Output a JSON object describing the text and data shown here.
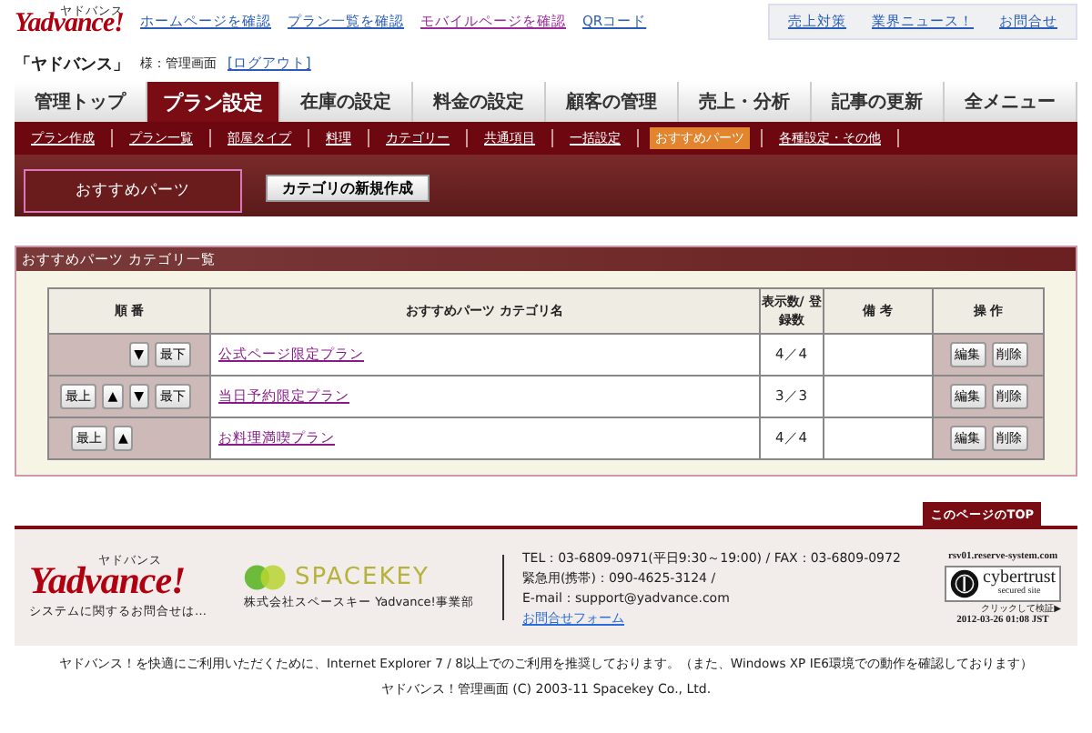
{
  "header": {
    "logo": "Yadvance!",
    "logo_kana": "ヤドバンス",
    "links": [
      "ホームページを確認",
      "プラン一覧を確認",
      "モバイルページを確認",
      "QRコード"
    ],
    "right_links": [
      "売上対策",
      "業界ニュース！",
      "お問合せ"
    ]
  },
  "account": {
    "name": "「ヤドバンス」",
    "suffix": "様：管理画面",
    "logout": "[ログアウト]"
  },
  "tabs": [
    {
      "label": "管理トップ",
      "selected": false
    },
    {
      "label": "プラン設定",
      "selected": true
    },
    {
      "label": "在庫の設定",
      "selected": false
    },
    {
      "label": "料金の設定",
      "selected": false
    },
    {
      "label": "顧客の管理",
      "selected": false
    },
    {
      "label": "売上・分析",
      "selected": false
    },
    {
      "label": "記事の更新",
      "selected": false
    },
    {
      "label": "全メニュー",
      "selected": false
    }
  ],
  "subnav": [
    {
      "label": "プラン作成",
      "selected": false
    },
    {
      "label": "プラン一覧",
      "selected": false
    },
    {
      "label": "部屋タイプ",
      "selected": false
    },
    {
      "label": "料理",
      "selected": false
    },
    {
      "label": "カテゴリー",
      "selected": false
    },
    {
      "label": "共通項目",
      "selected": false
    },
    {
      "label": "一括設定",
      "selected": false
    },
    {
      "label": "おすすめパーツ",
      "selected": true
    },
    {
      "label": "各種設定・その他",
      "selected": false
    }
  ],
  "page": {
    "title": "おすすめパーツ",
    "new_button": "カテゴリの新規作成"
  },
  "section": {
    "title": "おすすめパーツ カテゴリ一覧",
    "table": {
      "columns": [
        "順 番",
        "おすすめパーツ カテゴリ名",
        "表示数/ 登録数",
        "備 考",
        "操 作"
      ],
      "rows": [
        {
          "order_buttons": [
            "▼",
            "最下"
          ],
          "name": "公式ページ限定プラン",
          "count": "4／4",
          "actions": [
            "編集",
            "削除"
          ]
        },
        {
          "order_buttons": [
            "最上",
            "▲",
            "▼",
            "最下"
          ],
          "name": "当日予約限定プラン",
          "count": "3／3",
          "actions": [
            "編集",
            "削除"
          ]
        },
        {
          "order_buttons": [
            "最上",
            "▲"
          ],
          "name": "お料理満喫プラン",
          "count": "4／4",
          "actions": [
            "編集",
            "削除"
          ]
        }
      ]
    }
  },
  "footer": {
    "top_link": "このページのTOP",
    "logo": "Yadvance!",
    "logo_kana": "ヤドバンス",
    "logo_caption": "システムに関するお問合せは…",
    "company_logo": "SPACEKEY",
    "company": "株式会社スペースキー Yadvance!事業部",
    "contact": [
      "TEL：03-6809-0971(平日9:30～19:00) / FAX：03-6809-0972",
      "緊急用(携帯)：090-4625-3124 /",
      "E-mail：support@yadvance.com"
    ],
    "contact_link": "お問合せフォーム",
    "server": "rsv01.reserve-system.com",
    "seal_brand": "cybertrust",
    "seal_sub": "secured site",
    "seal_verify": "クリックして検証▶",
    "seal_date": "2012-03-26 01:08 JST",
    "notice": "ヤドバンス！を快適にご利用いただくために、Internet Explorer 7 / 8以上でのご利用を推奨しております。（また、Windows XP IE6環境での動作を確認しております）",
    "copyright": "ヤドバンス！管理画面 (C) 2003-11 Spacekey Co., Ltd."
  }
}
